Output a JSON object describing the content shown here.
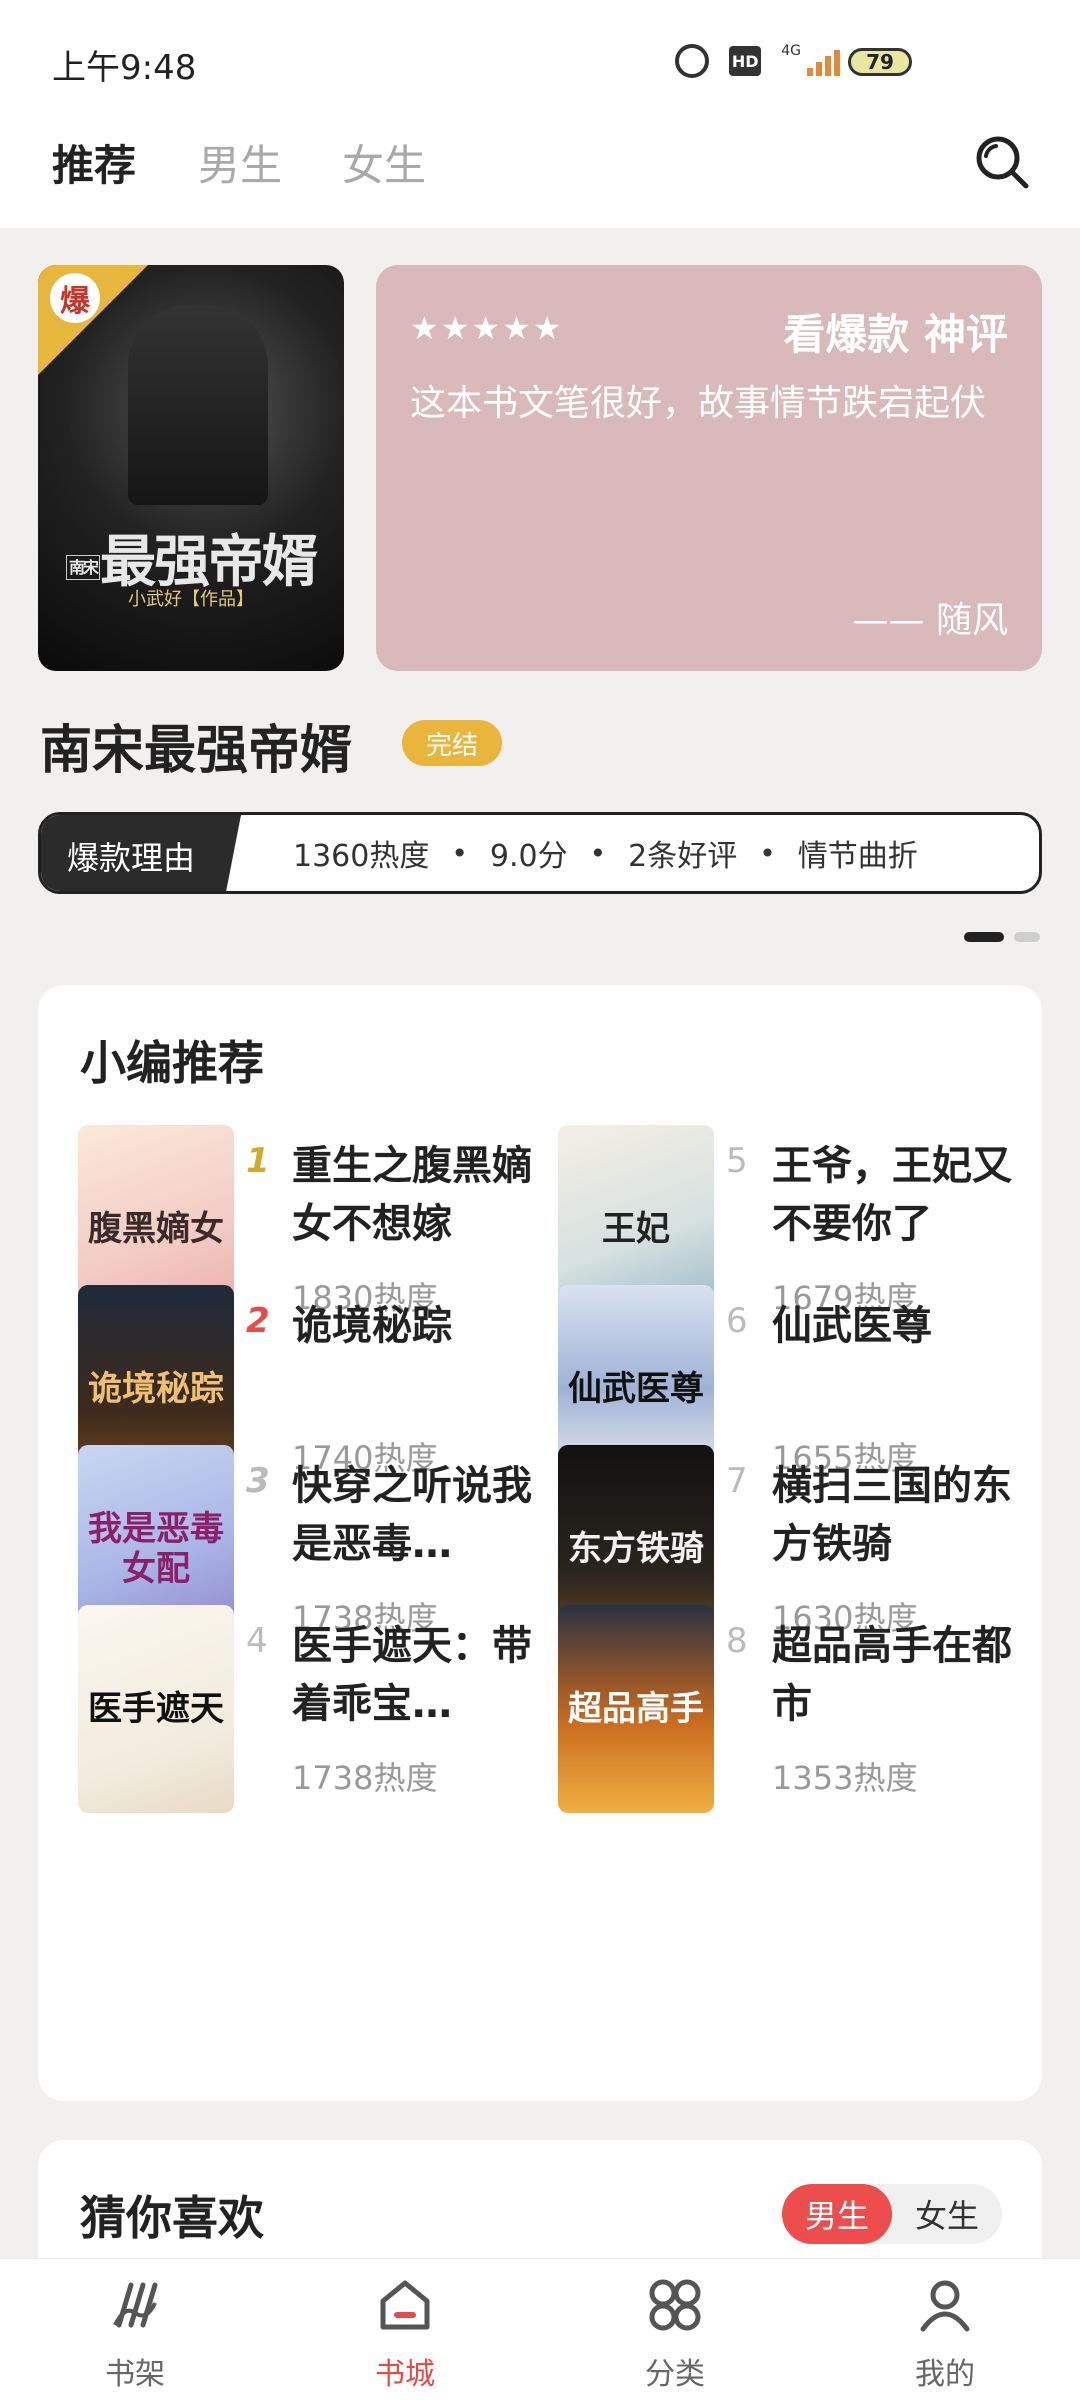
{
  "status_bar": {
    "time": "上午9:48",
    "network": "4G",
    "battery": "79"
  },
  "top_tabs": [
    {
      "label": "推荐",
      "active": true
    },
    {
      "label": "男生",
      "active": false
    },
    {
      "label": "女生",
      "active": false
    }
  ],
  "featured": {
    "cover_title": "最强帝婿",
    "cover_badge": "爆",
    "cover_author_line": "小武好【作品】",
    "cover_side_label": "南宋",
    "stars": "★★★★★",
    "review_head": "看爆款 神评",
    "review_text": "这本书文笔很好，故事情节跌宕起伏",
    "review_author": "—— 随风",
    "book_title": "南宋最强帝婿",
    "status": "完结",
    "reason_label": "爆款理由",
    "reasons": [
      "1360热度",
      "9.0分",
      "2条好评",
      "情节曲折"
    ]
  },
  "editor_picks": {
    "title": "小编推荐",
    "items": [
      {
        "rank": "1",
        "name": "重生之腹黑嫡女不想嫁",
        "heat": "1830热度",
        "cover_text": "腹黑嫡女"
      },
      {
        "rank": "2",
        "name": "诡境秘踪",
        "heat": "1740热度",
        "cover_text": "诡境秘踪"
      },
      {
        "rank": "3",
        "name": "快穿之听说我是恶毒…",
        "heat": "1738热度",
        "cover_text": "我是恶毒女配"
      },
      {
        "rank": "4",
        "name": "医手遮天：带着乖宝…",
        "heat": "1738热度",
        "cover_text": "医手遮天"
      },
      {
        "rank": "5",
        "name": "王爷，王妃又不要你了",
        "heat": "1679热度",
        "cover_text": "王妃"
      },
      {
        "rank": "6",
        "name": "仙武医尊",
        "heat": "1655热度",
        "cover_text": "仙武医尊"
      },
      {
        "rank": "7",
        "name": "横扫三国的东方铁骑",
        "heat": "1630热度",
        "cover_text": "东方铁骑"
      },
      {
        "rank": "8",
        "name": "超品高手在都市",
        "heat": "1353热度",
        "cover_text": "超品高手"
      }
    ]
  },
  "guess": {
    "title": "猜你喜欢",
    "options": [
      {
        "label": "男生",
        "selected": true
      },
      {
        "label": "女生",
        "selected": false
      }
    ]
  },
  "bottom_nav": [
    {
      "label": "书架",
      "icon": "bookshelf-icon",
      "active": false
    },
    {
      "label": "书城",
      "icon": "bookstore-icon",
      "active": true
    },
    {
      "label": "分类",
      "icon": "category-icon",
      "active": false
    },
    {
      "label": "我的",
      "icon": "profile-icon",
      "active": false
    }
  ],
  "colors": {
    "accent": "#e84a4a",
    "badge_gold": "#e9b53c",
    "review_card": "#d9b9b9",
    "rank_gold": "#d4a92c",
    "rank_red": "#e84a4a",
    "rank_gray": "#bbbbbb"
  }
}
